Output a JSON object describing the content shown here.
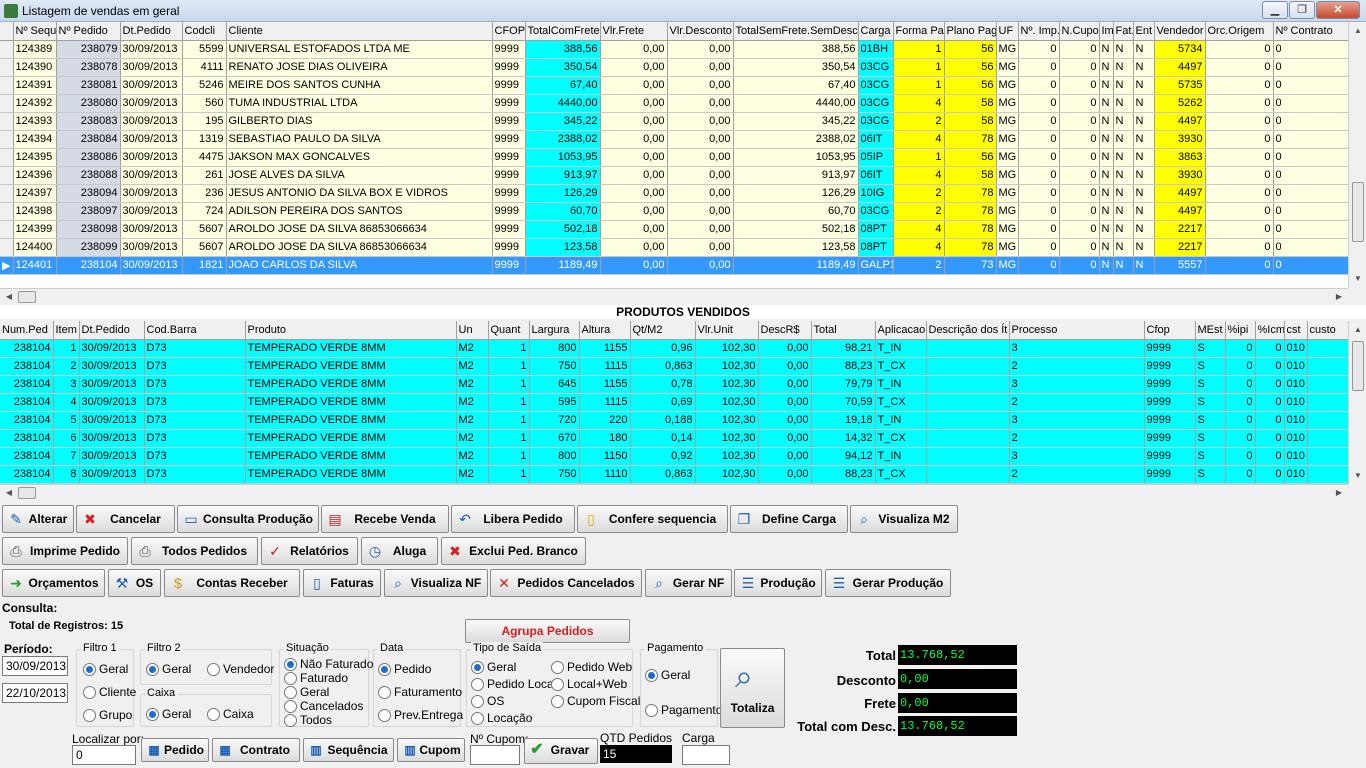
{
  "window": {
    "title": "Listagem de vendas em geral",
    "min": "▁",
    "max": "❐",
    "close": "✕"
  },
  "vendas": {
    "columns": [
      "Nº Sequ",
      "Nº Pedido",
      "Dt.Pedido",
      "Codcli",
      "Cliente",
      "CFOP",
      "TotalComFrete",
      "Vlr.Frete",
      "Vlr.Desconto",
      "TotalSemFrete.SemDesc",
      "Carga",
      "Forma Pa",
      "Plano Pag",
      "UF",
      "Nº. Imp.",
      "N.Cupo",
      "Im",
      "Fat.",
      "Ent",
      "Vendedor",
      "Orc.Origem",
      "Nº Contrato"
    ],
    "rows": [
      [
        "124389",
        "238079",
        "30/09/2013",
        "5599",
        "UNIVERSAL ESTOFADOS LTDA ME",
        "9999",
        "388,56",
        "0,00",
        "0,00",
        "388,56",
        "01BH",
        "1",
        "56",
        "MG",
        "0",
        "0",
        "N",
        "N",
        "N",
        "5734",
        "0",
        "0"
      ],
      [
        "124390",
        "238078",
        "30/09/2013",
        "4111",
        "RENATO JOSE DIAS OLIVEIRA",
        "9999",
        "350,54",
        "0,00",
        "0,00",
        "350,54",
        "03CG",
        "1",
        "56",
        "MG",
        "0",
        "0",
        "N",
        "N",
        "N",
        "4497",
        "0",
        "0"
      ],
      [
        "124391",
        "238081",
        "30/09/2013",
        "5246",
        "MEIRE DOS SANTOS CUNHA",
        "9999",
        "67,40",
        "0,00",
        "0,00",
        "67,40",
        "03CG",
        "1",
        "56",
        "MG",
        "0",
        "0",
        "N",
        "N",
        "N",
        "5735",
        "0",
        "0"
      ],
      [
        "124392",
        "238080",
        "30/09/2013",
        "560",
        "TUMA INDUSTRIAL LTDA",
        "9999",
        "4440,00",
        "0,00",
        "0,00",
        "4440,00",
        "03CG",
        "4",
        "58",
        "MG",
        "0",
        "0",
        "N",
        "N",
        "N",
        "5262",
        "0",
        "0"
      ],
      [
        "124393",
        "238083",
        "30/09/2013",
        "195",
        "GILBERTO DIAS",
        "9999",
        "345,22",
        "0,00",
        "0,00",
        "345,22",
        "03CG",
        "2",
        "58",
        "MG",
        "0",
        "0",
        "N",
        "N",
        "N",
        "4497",
        "0",
        "0"
      ],
      [
        "124394",
        "238084",
        "30/09/2013",
        "1319",
        "SEBASTIAO PAULO DA SILVA",
        "9999",
        "2388,02",
        "0,00",
        "0,00",
        "2388,02",
        "06IT",
        "4",
        "78",
        "MG",
        "0",
        "0",
        "N",
        "N",
        "N",
        "3930",
        "0",
        "0"
      ],
      [
        "124395",
        "238086",
        "30/09/2013",
        "4475",
        "JAKSON MAX GONCALVES",
        "9999",
        "1053,95",
        "0,00",
        "0,00",
        "1053,95",
        "05IP",
        "1",
        "56",
        "MG",
        "0",
        "0",
        "N",
        "N",
        "N",
        "3863",
        "0",
        "0"
      ],
      [
        "124396",
        "238088",
        "30/09/2013",
        "261",
        "JOSE ALVES DA SILVA",
        "9999",
        "913,97",
        "0,00",
        "0,00",
        "913,97",
        "06IT",
        "4",
        "58",
        "MG",
        "0",
        "0",
        "N",
        "N",
        "N",
        "3930",
        "0",
        "0"
      ],
      [
        "124397",
        "238094",
        "30/09/2013",
        "236",
        "JESUS ANTONIO DA SILVA BOX E VIDROS",
        "9999",
        "126,29",
        "0,00",
        "0,00",
        "126,29",
        "10IG",
        "2",
        "78",
        "MG",
        "0",
        "0",
        "N",
        "N",
        "N",
        "4497",
        "0",
        "0"
      ],
      [
        "124398",
        "238097",
        "30/09/2013",
        "724",
        "ADILSON PEREIRA DOS SANTOS",
        "9999",
        "60,70",
        "0,00",
        "0,00",
        "60,70",
        "03CG",
        "2",
        "78",
        "MG",
        "0",
        "0",
        "N",
        "N",
        "N",
        "4497",
        "0",
        "0"
      ],
      [
        "124399",
        "238098",
        "30/09/2013",
        "5607",
        "AROLDO JOSE DA SILVA 86853066634",
        "9999",
        "502,18",
        "0,00",
        "0,00",
        "502,18",
        "08PT",
        "4",
        "78",
        "MG",
        "0",
        "0",
        "N",
        "N",
        "N",
        "2217",
        "0",
        "0"
      ],
      [
        "124400",
        "238099",
        "30/09/2013",
        "5607",
        "AROLDO JOSE DA SILVA 86853066634",
        "9999",
        "123,58",
        "0,00",
        "0,00",
        "123,58",
        "08PT",
        "4",
        "78",
        "MG",
        "0",
        "0",
        "N",
        "N",
        "N",
        "2217",
        "0",
        "0"
      ],
      [
        "124401",
        "238104",
        "30/09/2013",
        "1821",
        "JOAO CARLOS DA SILVA",
        "9999",
        "1189,49",
        "0,00",
        "0,00",
        "1189,49",
        "GALP1",
        "2",
        "73",
        "MG",
        "0",
        "0",
        "N",
        "N",
        "N",
        "5557",
        "0",
        "0"
      ]
    ]
  },
  "produtos": {
    "title": "PRODUTOS VENDIDOS",
    "columns": [
      "Num.Ped",
      "Item",
      "Dt.Pedido",
      "Cod.Barra",
      "Produto",
      "Un",
      "Quant",
      "Largura",
      "Altura",
      "Qt/M2",
      "Vlr.Unit",
      "DescR$",
      "Total",
      "Aplicacao",
      "Descrição dos Ít",
      "Processo",
      "Cfop",
      "MEst",
      "%ipi",
      "%Icm",
      "cst",
      "custo"
    ],
    "rows": [
      [
        "238104",
        "1",
        "30/09/2013",
        "D73",
        "TEMPERADO VERDE 8MM",
        "M2",
        "1",
        "800",
        "1155",
        "0,96",
        "102,30",
        "0,00",
        "98,21",
        "T_IN",
        "",
        "3",
        "9999",
        "S",
        "0",
        "0",
        "010",
        ""
      ],
      [
        "238104",
        "2",
        "30/09/2013",
        "D73",
        "TEMPERADO VERDE 8MM",
        "M2",
        "1",
        "750",
        "1115",
        "0,863",
        "102,30",
        "0,00",
        "88,23",
        "T_CX",
        "",
        "2",
        "9999",
        "S",
        "0",
        "0",
        "010",
        ""
      ],
      [
        "238104",
        "3",
        "30/09/2013",
        "D73",
        "TEMPERADO VERDE 8MM",
        "M2",
        "1",
        "645",
        "1155",
        "0,78",
        "102,30",
        "0,00",
        "79,79",
        "T_IN",
        "",
        "3",
        "9999",
        "S",
        "0",
        "0",
        "010",
        ""
      ],
      [
        "238104",
        "4",
        "30/09/2013",
        "D73",
        "TEMPERADO VERDE 8MM",
        "M2",
        "1",
        "595",
        "1115",
        "0,69",
        "102,30",
        "0,00",
        "70,59",
        "T_CX",
        "",
        "2",
        "9999",
        "S",
        "0",
        "0",
        "010",
        ""
      ],
      [
        "238104",
        "5",
        "30/09/2013",
        "D73",
        "TEMPERADO VERDE 8MM",
        "M2",
        "1",
        "720",
        "220",
        "0,188",
        "102,30",
        "0,00",
        "19,18",
        "T_IN",
        "",
        "3",
        "9999",
        "S",
        "0",
        "0",
        "010",
        ""
      ],
      [
        "238104",
        "6",
        "30/09/2013",
        "D73",
        "TEMPERADO VERDE 8MM",
        "M2",
        "1",
        "670",
        "180",
        "0,14",
        "102,30",
        "0,00",
        "14,32",
        "T_CX",
        "",
        "2",
        "9999",
        "S",
        "0",
        "0",
        "010",
        ""
      ],
      [
        "238104",
        "7",
        "30/09/2013",
        "D73",
        "TEMPERADO VERDE 8MM",
        "M2",
        "1",
        "800",
        "1150",
        "0,92",
        "102,30",
        "0,00",
        "94,12",
        "T_IN",
        "",
        "3",
        "9999",
        "S",
        "0",
        "0",
        "010",
        ""
      ],
      [
        "238104",
        "8",
        "30/09/2013",
        "D73",
        "TEMPERADO VERDE 8MM",
        "M2",
        "1",
        "750",
        "1110",
        "0,863",
        "102,30",
        "0,00",
        "88,23",
        "T_CX",
        "",
        "2",
        "9999",
        "S",
        "0",
        "0",
        "010",
        ""
      ]
    ]
  },
  "toolbar": {
    "alterar": "Alterar",
    "cancelar": "Cancelar",
    "consulta_producao": "Consulta Produção",
    "recebe_venda": "Recebe Venda",
    "libera_pedido": "Libera Pedido",
    "confere_sequencia": "Confere sequencia",
    "define_carga": "Define Carga",
    "visualiza_m2": "Visualiza M2",
    "imprime_pedido": "Imprime Pedido",
    "todos_pedidos": "Todos Pedidos",
    "relatorios": "Relatórios",
    "aluga": "Aluga",
    "exclui_ped_branco": "Exclui Ped. Branco",
    "orcamentos": "Orçamentos",
    "os": "OS",
    "contas_receber": "Contas Receber",
    "faturas": "Faturas",
    "visualiza_nf": "Visualiza NF",
    "pedidos_cancelados": "Pedidos Cancelados",
    "gerar_nf": "Gerar NF",
    "producao": "Produção",
    "gerar_producao": "Gerar Produção"
  },
  "consulta": {
    "label": "Consulta:",
    "total_registros": "Total de Registros: 15",
    "agrupa": "Agrupa Pedidos",
    "periodo": {
      "label": "Período:",
      "inicio": "30/09/2013",
      "fim": "22/10/2013"
    },
    "filtro1": {
      "label": "Filtro 1",
      "options": [
        "Geral",
        "Cliente",
        "Grupo"
      ]
    },
    "filtro2": {
      "label": "Filtro 2",
      "options": [
        "Geral",
        "Vendedor"
      ]
    },
    "caixa": {
      "label": "Caixa",
      "options": [
        "Geral",
        "Caixa"
      ]
    },
    "situacao": {
      "label": "Situação",
      "options": [
        "Não Faturado",
        "Faturado",
        "Geral",
        "Cancelados",
        "Todos"
      ]
    },
    "data": {
      "label": "Data",
      "options": [
        "Pedido",
        "Faturamento",
        "Prev.Entrega"
      ]
    },
    "tipo_saida": {
      "label": "Tipo de Saída",
      "options": [
        "Geral",
        "Pedido Local",
        "OS",
        "Locação",
        "Pedido Web",
        "Local+Web",
        "Cupom Fiscal"
      ]
    },
    "pagamento": {
      "label": "Pagamento",
      "options": [
        "Geral",
        "Pagamento"
      ]
    },
    "totaliza": "Totaliza",
    "localizar": {
      "label": "Localizar por:",
      "value": "0"
    },
    "btn_pedido": "Pedido",
    "btn_contrato": "Contrato",
    "btn_sequencia": "Sequência",
    "btn_cupom": "Cupom",
    "n_cupom": "Nº Cupom:",
    "gravar": "Gravar",
    "qtd_pedidos": {
      "label": "QTD Pedidos",
      "value": "15"
    },
    "carga": "Carga"
  },
  "totals": {
    "total_label": "Total",
    "total": "13.768,52",
    "desconto_label": "Desconto",
    "desconto": "0,00",
    "frete_label": "Frete",
    "frete": "0,00",
    "total_desc_label": "Total com Desc.",
    "total_desc": "13.768,52"
  }
}
